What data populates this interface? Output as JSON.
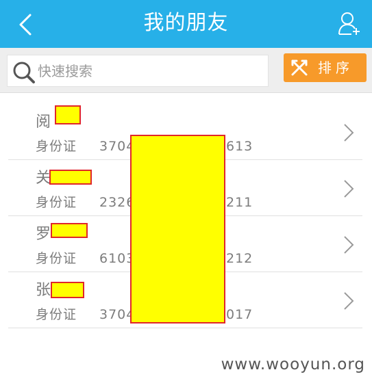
{
  "header": {
    "title": "我的朋友",
    "back_icon": "chevron-left-icon",
    "add_icon": "add-user-icon"
  },
  "search": {
    "placeholder": "快速搜索"
  },
  "sort": {
    "label": "排序",
    "icon": "shuffle-icon",
    "color": "#f79a2a"
  },
  "friends": [
    {
      "name": "阅",
      "id_label": "身份证",
      "id_prefix": "3704",
      "id_suffix": "613"
    },
    {
      "name": "关",
      "id_label": "身份证",
      "id_prefix": "2326",
      "id_suffix": "211"
    },
    {
      "name": "罗",
      "id_label": "身份证",
      "id_prefix": "6103",
      "id_suffix": "212"
    },
    {
      "name": "张",
      "id_label": "身份证",
      "id_prefix": "3704",
      "id_suffix": "017"
    }
  ],
  "watermark": "www.wooyun.org",
  "colors": {
    "header_bg": "#27b0e8",
    "redaction_fill": "#ffff00",
    "redaction_border": "#e0262a"
  }
}
